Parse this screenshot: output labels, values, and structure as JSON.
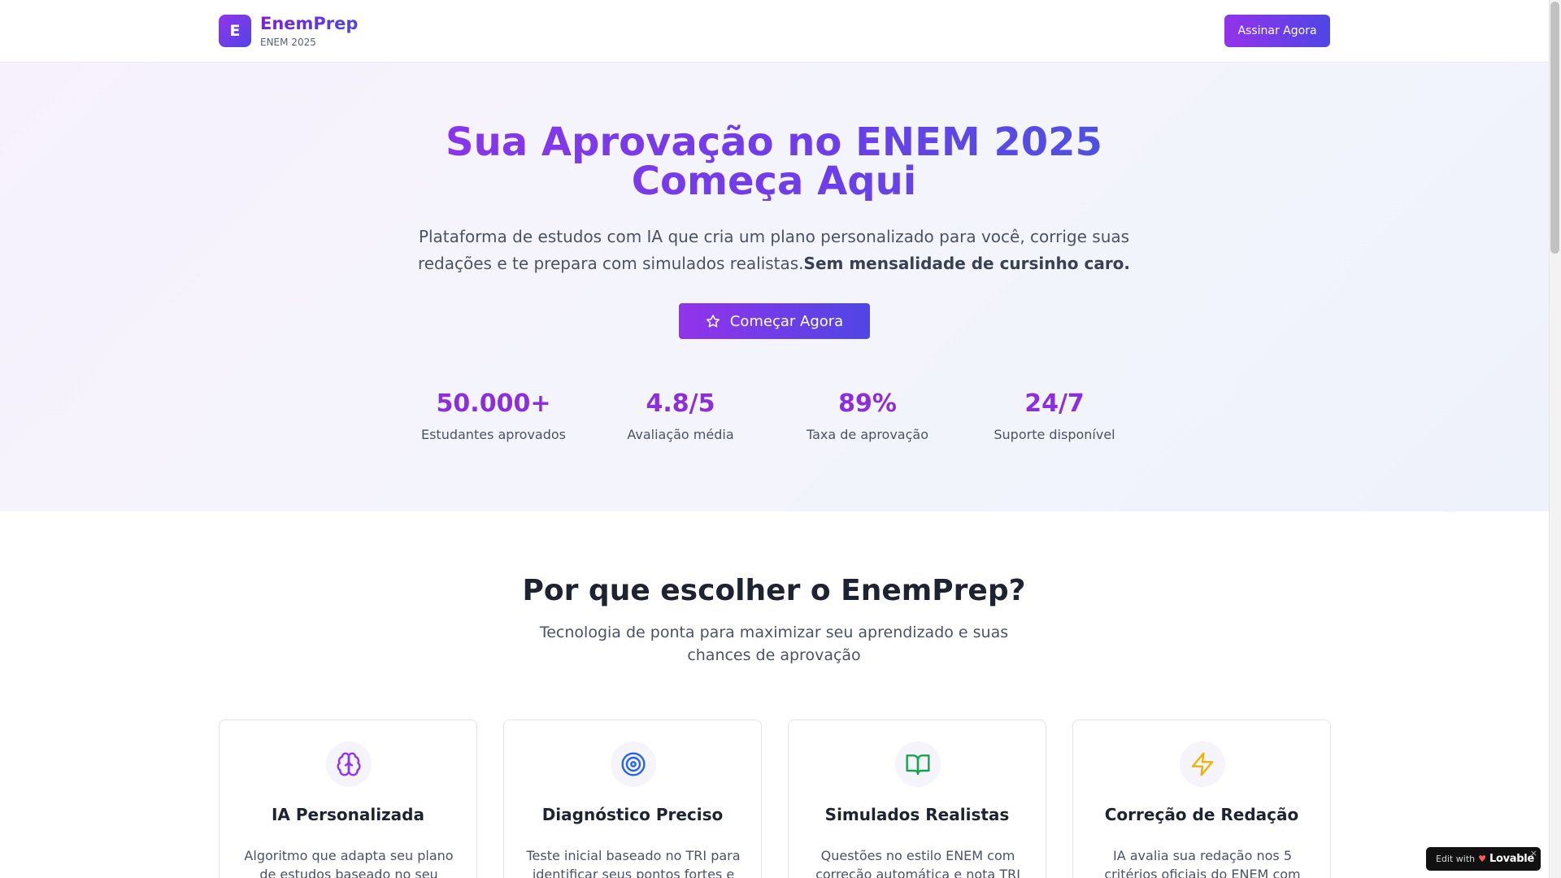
{
  "header": {
    "logo_letter": "E",
    "brand_name": "EnemPrep",
    "brand_sub": "ENEM 2025",
    "cta_label": "Assinar Agora"
  },
  "hero": {
    "title_line1": "Sua Aprovação no ENEM 2025",
    "title_line2": "Começa Aqui",
    "desc_line1": "Plataforma de estudos com IA que cria um plano personalizado para você, corrige suas",
    "desc_line2": "redações e te prepara com simulados realistas.",
    "desc_bold": "Sem mensalidade de cursinho caro.",
    "cta_label": "Começar Agora",
    "cta_icon": "star-icon"
  },
  "stats": [
    {
      "value": "50.000+",
      "label": "Estudantes aprovados"
    },
    {
      "value": "4.8/5",
      "label": "Avaliação média"
    },
    {
      "value": "89%",
      "label": "Taxa de aprovação"
    },
    {
      "value": "24/7",
      "label": "Suporte disponível"
    }
  ],
  "features": {
    "title": "Por que escolher o EnemPrep?",
    "sub_line1": "Tecnologia de ponta para maximizar seu aprendizado e suas",
    "sub_line2": "chances de aprovação",
    "cards": [
      {
        "icon": "brain-icon",
        "color": "#9333ea",
        "title": "IA Personalizada",
        "desc_line1": "Algoritmo que adapta seu plano",
        "desc_line2": "de estudos baseado no seu"
      },
      {
        "icon": "target-icon",
        "color": "#2563eb",
        "title": "Diagnóstico Preciso",
        "desc_line1": "Teste inicial baseado no TRI para",
        "desc_line2": "identificar seus pontos fortes e"
      },
      {
        "icon": "book-open-icon",
        "color": "#16a34a",
        "title": "Simulados Realistas",
        "desc_line1": "Questões no estilo ENEM com",
        "desc_line2": "correção automática e nota TRI"
      },
      {
        "icon": "lightning-icon",
        "color": "#eab308",
        "title": "Correção de Redação",
        "desc_line1": "IA avalia sua redação nos 5",
        "desc_line2": "critérios oficiais do ENEM com"
      }
    ]
  },
  "badge": {
    "edit_label": "Edit with",
    "brand": "Lovable",
    "close": "×"
  }
}
